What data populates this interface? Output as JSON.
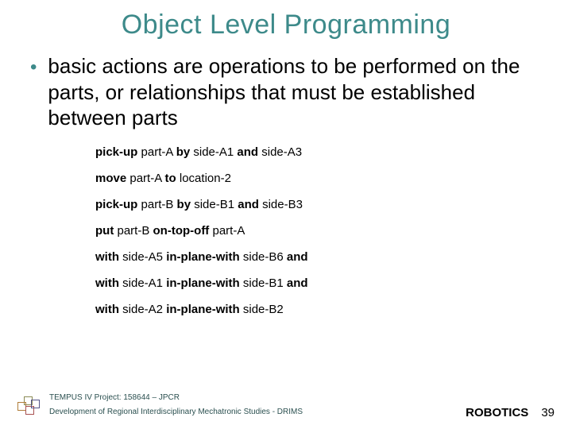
{
  "title": "Object Level Programming",
  "bullet": {
    "text": "basic actions are operations to be performed on the parts, or relationships that must be established between parts"
  },
  "code": {
    "l1": {
      "a": "pick-up",
      "b": " part-A ",
      "c": "by",
      "d": " side-A1 ",
      "e": "and",
      "f": " side-A3"
    },
    "l2": {
      "a": "move",
      "b": " part-A ",
      "c": "to",
      "d": " location-2"
    },
    "l3": {
      "a": "pick-up",
      "b": " part-B ",
      "c": "by",
      "d": " side-B1 ",
      "e": "and",
      "f": " side-B3"
    },
    "l4": {
      "a": "put",
      "b": " part-B ",
      "c": "on-top-off",
      "d": " part-A"
    },
    "l5": {
      "a": "with",
      "b": " side-A5 ",
      "c": "in-plane-with",
      "d": " side-B6 ",
      "e": "and"
    },
    "l6": {
      "a": "with",
      "b": " side-A1 ",
      "c": "in-plane-with",
      "d": " side-B1 ",
      "e": "and"
    },
    "l7": {
      "a": "with",
      "b": " side-A2 ",
      "c": "in-plane-with",
      "d": " side-B2"
    }
  },
  "footer": {
    "line1": "TEMPUS IV Project: 158644 – JPCR",
    "line2": "Development of Regional Interdisciplinary Mechatronic Studies - DRIMS",
    "label": "ROBOTICS",
    "page": "39"
  }
}
